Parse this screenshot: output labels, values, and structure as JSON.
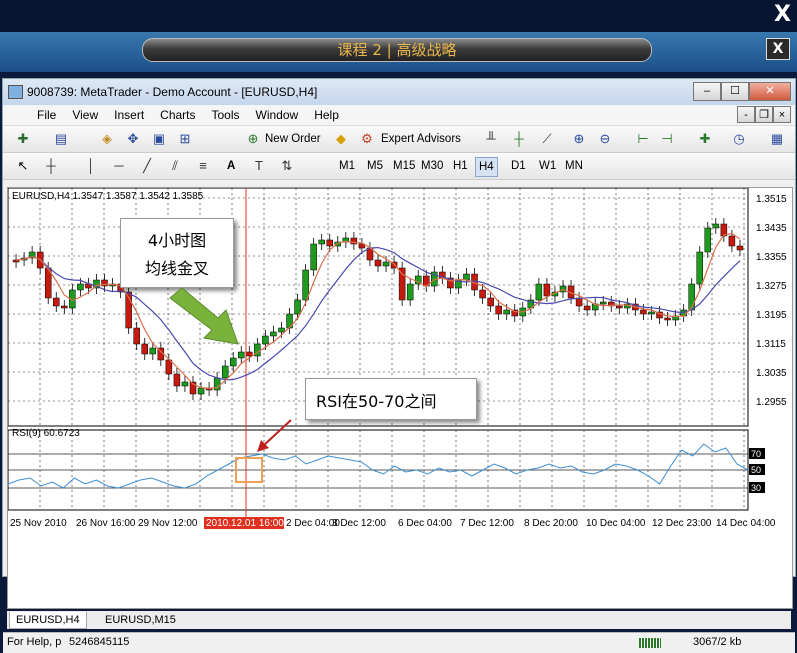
{
  "lesson_title": "课程 2 | 高级战略",
  "close_glyph": "X",
  "window": {
    "title": "9008739: MetaTrader - Demo Account - [EURUSD,H4]"
  },
  "menu": [
    "File",
    "View",
    "Insert",
    "Charts",
    "Tools",
    "Window",
    "Help"
  ],
  "toolbar": {
    "new_order": "New Order",
    "expert_advisors": "Expert Advisors"
  },
  "timeframes": [
    "M1",
    "M5",
    "M15",
    "M30",
    "H1",
    "H4",
    "D1",
    "W1",
    "MN"
  ],
  "toolbar2": {
    "text_tool": "A"
  },
  "chart": {
    "symbol_info": "EURUSD,H4  1.3547 1.3587 1.3542 1.3585",
    "price_labels": [
      "1.3515",
      "1.3435",
      "1.3355",
      "1.3275",
      "1.3195",
      "1.3115",
      "1.3035",
      "1.2955"
    ],
    "rsi_info": "RSI(9) 60.6723",
    "rsi_levels": [
      "70",
      "50",
      "30"
    ],
    "time_labels": [
      "25 Nov 2010",
      "26 Nov 16:00",
      "29 Nov 12:00",
      "2010.12.01 16:00",
      "2 Dec 04:00",
      "3 Dec 12:00",
      "6 Dec 04:00",
      "7 Dec 12:00",
      "8 Dec 20:00",
      "10 Dec 04:00",
      "12 Dec 23:00",
      "14 Dec 04:00"
    ],
    "crosshair_label": "2010.12.01 16:00"
  },
  "callouts": {
    "golden_cross_line1": "4小时图",
    "golden_cross_line2": "均线金叉",
    "rsi_note": "RSI在50-70之间"
  },
  "tabs": [
    "EURUSD,H4",
    "EURUSD,M15"
  ],
  "status": {
    "help": "For Help, p",
    "id": "5246845115",
    "kb": "3067/2 kb"
  },
  "colors": {
    "bull": "#1e9a1e",
    "bear": "#c41a10",
    "ma_fast": "#d9704a",
    "ma_slow": "#4a4ab0",
    "rsi": "#3d8fd6",
    "crosshair": "#e03020"
  }
}
